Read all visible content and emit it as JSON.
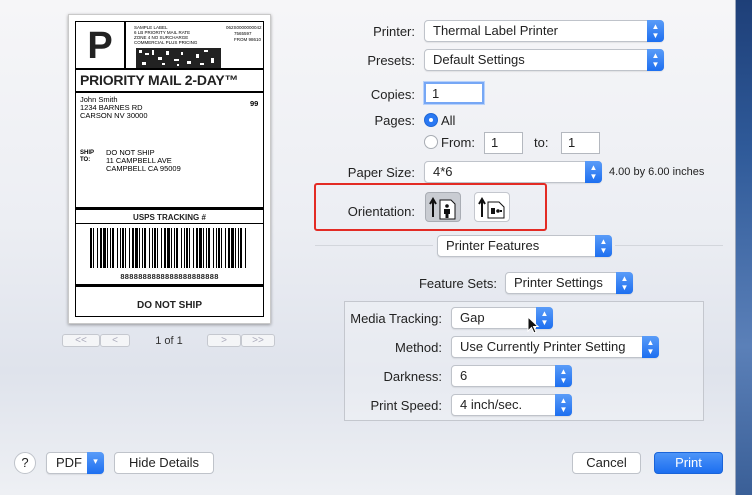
{
  "label": {
    "big_letter": "P",
    "header_lines": [
      "SAMPLE LABEL",
      "6 LB PRIORITY MAIL RATE",
      "ZONE 4 NO SURCHARGE",
      "COMMERCIAL PLUS PRICING"
    ],
    "right_lines": [
      "062S0000000042",
      "7565597",
      "FROM 98610"
    ],
    "service_title": "PRIORITY MAIL 2-DAY™",
    "sender_lines": [
      "John Smith",
      "1234 BARNES RD",
      "CARSON NV 30000"
    ],
    "sender_code": "99",
    "ship_to_label": "SHIP\nTO:",
    "recipient_lines": [
      "DO NOT SHIP",
      "11 CAMPBELL AVE",
      "CAMPBELL CA 95009"
    ],
    "tracking_heading": "USPS TRACKING #",
    "tracking_number": "8888888888888888888888",
    "footer": "DO NOT SHIP"
  },
  "pager": {
    "first": "<<",
    "prev": "<",
    "indicator": "1 of 1",
    "next": ">",
    "last": ">>"
  },
  "form": {
    "printer_label": "Printer:",
    "printer_value": "Thermal Label Printer",
    "presets_label": "Presets:",
    "presets_value": "Default Settings",
    "copies_label": "Copies:",
    "copies_value": "1",
    "pages_label": "Pages:",
    "pages_all": "All",
    "pages_from": "From:",
    "from_value": "1",
    "to_label": "to:",
    "to_value": "1",
    "paper_label": "Paper Size:",
    "paper_value": "4*6",
    "paper_dims": "4.00 by 6.00 inches",
    "orientation_label": "Orientation:",
    "section_value": "Printer Features",
    "feature_sets_label": "Feature Sets:",
    "feature_sets_value": "Printer Settings",
    "media_tracking_label": "Media Tracking:",
    "media_tracking_value": "Gap",
    "method_label": "Method:",
    "method_value": "Use Currently Printer Setting",
    "darkness_label": "Darkness:",
    "darkness_value": "6",
    "print_speed_label": "Print Speed:",
    "print_speed_value": "4 inch/sec."
  },
  "footer": {
    "help": "?",
    "pdf": "PDF",
    "hide_details": "Hide Details",
    "cancel": "Cancel",
    "print": "Print"
  },
  "colors": {
    "accent": "#2a79f3",
    "highlight": "#e32b24"
  }
}
